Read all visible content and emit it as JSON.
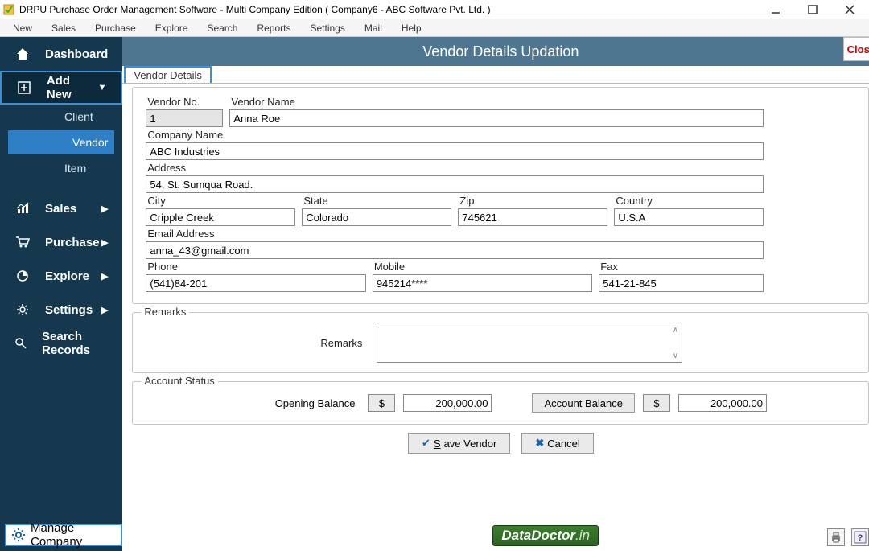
{
  "window": {
    "title": "DRPU Purchase Order Management Software - Multi Company Edition ( Company6 - ABC Software Pvt. Ltd. )"
  },
  "menu": [
    "New",
    "Sales",
    "Purchase",
    "Explore",
    "Search",
    "Reports",
    "Settings",
    "Mail",
    "Help"
  ],
  "sidebar": {
    "dashboard": "Dashboard",
    "addnew": "Add New",
    "subs": {
      "client": "Client",
      "vendor": "Vendor",
      "item": "Item"
    },
    "sales": "Sales",
    "purchase": "Purchase",
    "explore": "Explore",
    "settings": "Settings",
    "search": "Search Records",
    "manage": "Manage Company"
  },
  "page": {
    "title": "Vendor Details Updation",
    "close": "Close",
    "tab": "Vendor Details"
  },
  "form": {
    "vendor_no_label": "Vendor No.",
    "vendor_no": "1",
    "vendor_name_label": "Vendor Name",
    "vendor_name": "Anna Roe",
    "company_label": "Company Name",
    "company": "ABC Industries",
    "address_label": "Address",
    "address": "54, St. Sumqua Road.",
    "city_label": "City",
    "city": "Cripple Creek",
    "state_label": "State",
    "state": "Colorado",
    "zip_label": "Zip",
    "zip": "745621",
    "country_label": "Country",
    "country": "U.S.A",
    "email_label": "Email Address",
    "email": "anna_43@gmail.com",
    "phone_label": "Phone",
    "phone": "(541)84-201",
    "mobile_label": "Mobile",
    "mobile": "945214****",
    "fax_label": "Fax",
    "fax": "541-21-845"
  },
  "remarks": {
    "legend": "Remarks",
    "label": "Remarks",
    "value": ""
  },
  "account": {
    "legend": "Account Status",
    "opening_label": "Opening Balance",
    "currency": "$",
    "opening_value": "200,000.00",
    "balance_btn": "Account Balance",
    "balance_value": "200,000.00"
  },
  "actions": {
    "save": "Save Vendor",
    "cancel": "Cancel"
  },
  "footer": {
    "brand_a": "DataDoctor",
    "brand_b": ".in"
  }
}
